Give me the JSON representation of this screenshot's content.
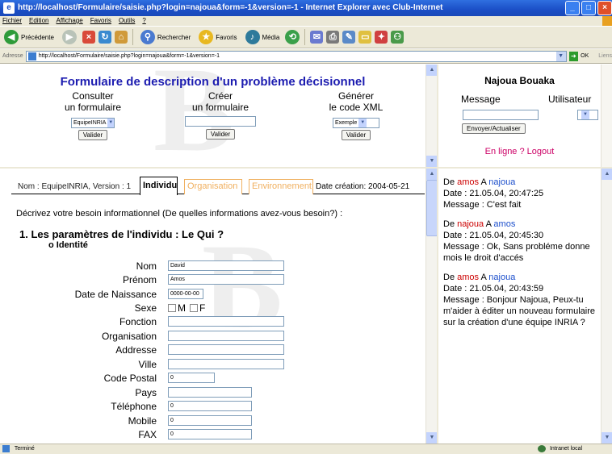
{
  "window": {
    "title": "http://localhost/Formulaire/saisie.php?login=najoua&form=-1&version=-1 - Internet Explorer avec Club-Internet",
    "min_label": "_",
    "max_label": "□",
    "close_label": "×"
  },
  "menu": [
    "Fichier",
    "Edition",
    "Affichage",
    "Favoris",
    "Outils",
    "?"
  ],
  "toolbar": {
    "back_label": "Précédente",
    "search_label": "Rechercher",
    "favorites_label": "Favoris",
    "media_label": "Média"
  },
  "address": {
    "label": "Adresse",
    "url": "http://localhost/Formulaire/saisie.php?login=najoua&form=-1&version=-1",
    "ok_label": "OK",
    "links_label": "Liens"
  },
  "top_left": {
    "heading": "Formulaire de description d'un problème décisionnel",
    "consult": {
      "line1": "Consulter",
      "line2": "un formulaire",
      "select_value": "EquipeINRIA",
      "button": "Valider"
    },
    "create": {
      "line1": "Créer",
      "line2": "un formulaire",
      "input_value": "",
      "button": "Valider"
    },
    "generate": {
      "line1": "Générer",
      "line2": "le code XML",
      "select_value": "Exemple",
      "button": "Valider"
    }
  },
  "top_right": {
    "user": "Najoua Bouaka",
    "message_label": "Message",
    "user_label": "Utilisateur",
    "message_value": "",
    "user_select_value": "",
    "send_button": "Envoyer/Actualiser",
    "online_logout": "En ligne ? Logout"
  },
  "form": {
    "info": "Nom : EquipeINRIA, Version : 1",
    "tabs": [
      "Individu",
      "Organisation",
      "Environnement"
    ],
    "creation_date": "Date création: 2004-05-21",
    "need_text": "Décrivez votre besoin informationnel (De quelles informations avez-vous besoin?) :",
    "section_title": "1. Les paramètres de l'individu : Le Qui ?",
    "subsection": "o Identité",
    "fields": [
      {
        "label": "Nom",
        "value": "David"
      },
      {
        "label": "Prénom",
        "value": "Amos"
      },
      {
        "label": "Date de Naissance",
        "value": "0000-00-00"
      },
      {
        "label": "Sexe",
        "value": ""
      },
      {
        "label": "Fonction",
        "value": ""
      },
      {
        "label": "Organisation",
        "value": ""
      },
      {
        "label": "Addresse",
        "value": ""
      },
      {
        "label": "Ville",
        "value": ""
      },
      {
        "label": "Code Postal",
        "value": "0"
      },
      {
        "label": "Pays",
        "value": ""
      },
      {
        "label": "Téléphone",
        "value": "0"
      },
      {
        "label": "Mobile",
        "value": "0"
      },
      {
        "label": "FAX",
        "value": "0"
      }
    ],
    "sexe_options": [
      "M",
      "F"
    ]
  },
  "chat": [
    {
      "de": "De",
      "from": "amos",
      "a": "A",
      "to": "najoua",
      "date": "Date : 21.05.04, 20:47:25",
      "message": "Message : C'est fait"
    },
    {
      "de": "De",
      "from": "najoua",
      "a": "A",
      "to": "amos",
      "date": "Date : 21.05.04, 20:45:30",
      "message": "Message : Ok, Sans probléme donne mois le droit d'accés"
    },
    {
      "de": "De",
      "from": "amos",
      "a": "A",
      "to": "najoua",
      "date": "Date : 21.05.04, 20:43:59",
      "message": "Message : Bonjour Najoua, Peux-tu m'aider à éditer un nouveau formulaire sur la création d'une équipe INRIA ?"
    }
  ],
  "status": {
    "text": "Terminé",
    "zone": "Intranet local"
  }
}
